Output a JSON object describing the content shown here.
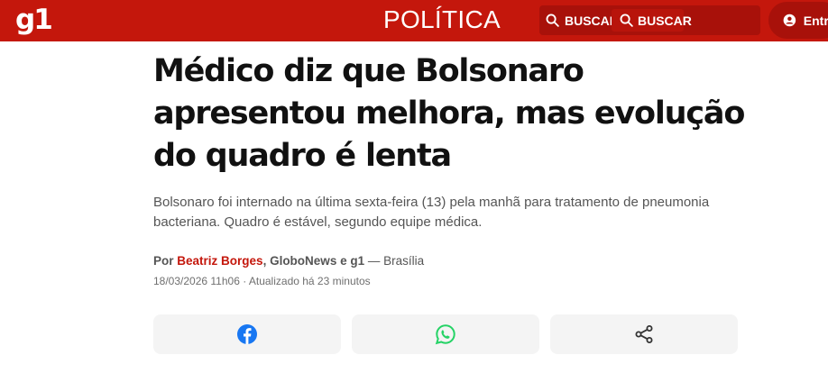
{
  "header": {
    "logo": "g1",
    "section": "POLÍTICA",
    "search_label": "BUSCAR",
    "search_placeholder": "BUSCAR",
    "login_label": "Entrar",
    "colors": {
      "brand": "#c4170c",
      "brand_dark": "#a8110a"
    },
    "icons": [
      "search-icon",
      "user-icon"
    ]
  },
  "article": {
    "headline": "Médico diz que Bolsonaro apresentou melhora, mas evolução do quadro é lenta",
    "subtitle": "Bolsonaro foi internado na última sexta-feira (13) pela manhã para tratamento de pneumonia bacteriana. Quadro é estável, segundo equipe médica.",
    "byline_prefix": "Por",
    "author": "Beatriz Borges",
    "byline_sources": ", GloboNews e g1",
    "byline_location": " — Brasília",
    "published": "18/03/2026 11h06 · Atualizado há 23 minutos"
  },
  "share": {
    "buttons": [
      {
        "name": "facebook",
        "icon": "facebook-icon",
        "color": "#1877f2"
      },
      {
        "name": "whatsapp",
        "icon": "whatsapp-icon",
        "color": "#25d366"
      },
      {
        "name": "share",
        "icon": "share-icon",
        "color": "#333333"
      }
    ]
  }
}
